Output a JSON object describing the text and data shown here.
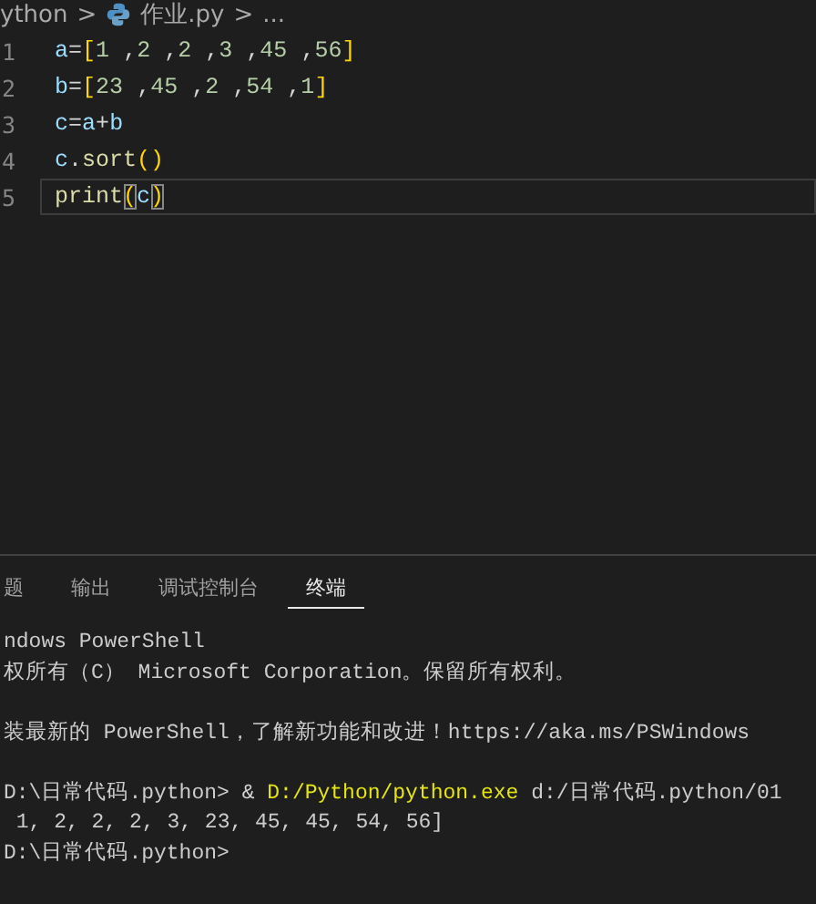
{
  "breadcrumb": {
    "folder": "ython",
    "separator": ">",
    "file": "作业.py",
    "more": "..."
  },
  "editor": {
    "lines": [
      {
        "number": "1",
        "current": false,
        "tokens": [
          {
            "kind": "var",
            "text": "a"
          },
          {
            "kind": "op",
            "text": "="
          },
          {
            "kind": "bracket",
            "text": "["
          },
          {
            "kind": "num",
            "text": "1"
          },
          {
            "kind": "op",
            "text": " ,"
          },
          {
            "kind": "num",
            "text": "2"
          },
          {
            "kind": "op",
            "text": " ,"
          },
          {
            "kind": "num",
            "text": "2"
          },
          {
            "kind": "op",
            "text": " ,"
          },
          {
            "kind": "num",
            "text": "3"
          },
          {
            "kind": "op",
            "text": " ,"
          },
          {
            "kind": "num",
            "text": "45"
          },
          {
            "kind": "op",
            "text": " ,"
          },
          {
            "kind": "num",
            "text": "56"
          },
          {
            "kind": "bracket",
            "text": "]"
          }
        ]
      },
      {
        "number": "2",
        "current": false,
        "tokens": [
          {
            "kind": "var",
            "text": "b"
          },
          {
            "kind": "op",
            "text": "="
          },
          {
            "kind": "bracket",
            "text": "["
          },
          {
            "kind": "num",
            "text": "23"
          },
          {
            "kind": "op",
            "text": " ,"
          },
          {
            "kind": "num",
            "text": "45"
          },
          {
            "kind": "op",
            "text": " ,"
          },
          {
            "kind": "num",
            "text": "2"
          },
          {
            "kind": "op",
            "text": " ,"
          },
          {
            "kind": "num",
            "text": "54"
          },
          {
            "kind": "op",
            "text": " ,"
          },
          {
            "kind": "num",
            "text": "1"
          },
          {
            "kind": "bracket",
            "text": "]"
          }
        ]
      },
      {
        "number": "3",
        "current": false,
        "tokens": [
          {
            "kind": "var",
            "text": "c"
          },
          {
            "kind": "op",
            "text": "="
          },
          {
            "kind": "var",
            "text": "a"
          },
          {
            "kind": "op",
            "text": "+"
          },
          {
            "kind": "var",
            "text": "b"
          }
        ]
      },
      {
        "number": "4",
        "current": false,
        "tokens": [
          {
            "kind": "var",
            "text": "c"
          },
          {
            "kind": "op",
            "text": "."
          },
          {
            "kind": "func",
            "text": "sort"
          },
          {
            "kind": "bracket",
            "text": "()"
          }
        ]
      },
      {
        "number": "5",
        "current": true,
        "tokens": [
          {
            "kind": "func",
            "text": "print"
          },
          {
            "kind": "match",
            "text": "("
          },
          {
            "kind": "var",
            "text": "c"
          },
          {
            "kind": "match",
            "text": ")"
          }
        ]
      }
    ]
  },
  "panel": {
    "tabs": [
      {
        "label": "题",
        "selected": false
      },
      {
        "label": "输出",
        "selected": false
      },
      {
        "label": "调试控制台",
        "selected": false
      },
      {
        "label": "终端",
        "selected": true
      }
    ],
    "terminal": [
      {
        "kind": "text",
        "tokens": [
          {
            "kind": "plain",
            "text": "ndows PowerShell"
          }
        ]
      },
      {
        "kind": "text",
        "tokens": [
          {
            "kind": "plain",
            "text": "权所有（C） Microsoft Corporation。保留所有权利。"
          }
        ]
      },
      {
        "kind": "blank"
      },
      {
        "kind": "text",
        "tokens": [
          {
            "kind": "plain",
            "text": "装最新的 PowerShell，了解新功能和改进！https://aka.ms/PSWindows"
          }
        ]
      },
      {
        "kind": "blank"
      },
      {
        "kind": "text",
        "tokens": [
          {
            "kind": "plain",
            "text": "D:\\日常代码.python> "
          },
          {
            "kind": "op",
            "text": "& "
          },
          {
            "kind": "cmd",
            "text": "D:/Python/python.exe"
          },
          {
            "kind": "plain",
            "text": " d:/日常代码.python/01"
          }
        ]
      },
      {
        "kind": "text",
        "tokens": [
          {
            "kind": "plain",
            "text": " 1, 2, 2, 2, 3, 23, 45, 45, 54, 56]"
          }
        ]
      },
      {
        "kind": "text",
        "tokens": [
          {
            "kind": "plain",
            "text": "D:\\日常代码.python>"
          }
        ]
      }
    ]
  }
}
